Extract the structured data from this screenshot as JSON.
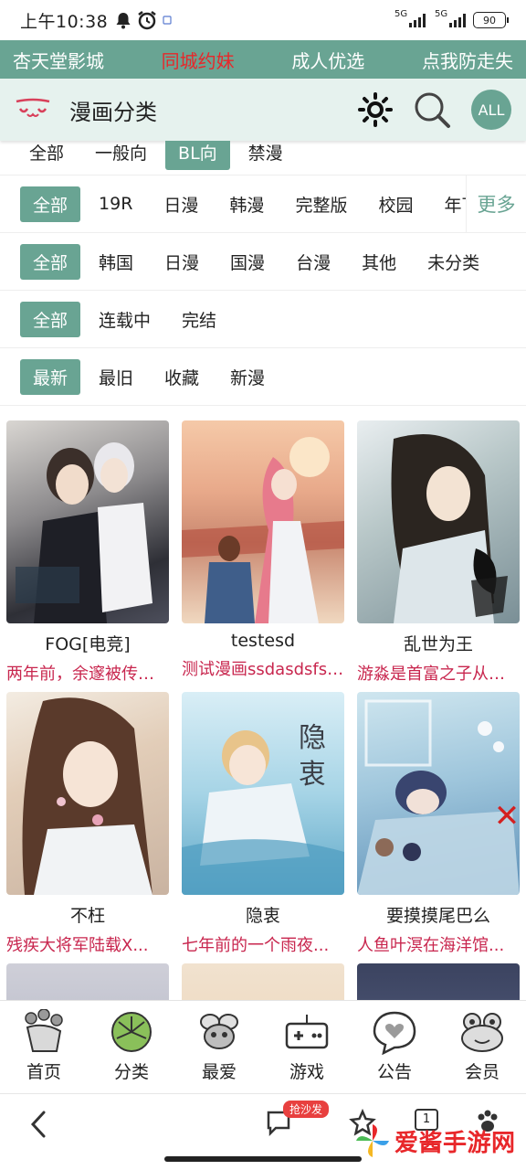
{
  "status": {
    "time": "上午10:38",
    "network1": "5G",
    "network2": "5G",
    "battery": "90"
  },
  "topnav": {
    "links": [
      "杏天堂影城",
      "同城约妹",
      "成人优选",
      "点我防走失"
    ]
  },
  "header": {
    "title": "漫画分类",
    "all_label": "ALL"
  },
  "filters": {
    "row0": [
      "全部",
      "一般向",
      "BL向",
      "禁漫"
    ],
    "row1": [
      "全部",
      "19R",
      "日漫",
      "韩漫",
      "完整版",
      "校园",
      "年下"
    ],
    "more_label": "更多",
    "row2": [
      "全部",
      "韩国",
      "日漫",
      "国漫",
      "台漫",
      "其他",
      "未分类"
    ],
    "row3": [
      "全部",
      "连载中",
      "完结"
    ],
    "row4": [
      "最新",
      "最旧",
      "收藏",
      "新漫"
    ]
  },
  "comics": [
    {
      "title": "FOG[电竞]",
      "desc": "两年前，余邃被传出..."
    },
    {
      "title": "testesd",
      "desc": "测试漫画ssdasdsfsdfsd"
    },
    {
      "title": "乱世为王",
      "desc": "游淼是首富之子从小..."
    },
    {
      "title": "不枉",
      "desc": "残疾大将军陆载X..."
    },
    {
      "title": "隐衷",
      "desc": "七年前的一个雨夜..."
    },
    {
      "title": "要摸摸尾巴么",
      "desc": "人鱼叶溟在海洋馆..."
    }
  ],
  "tabs": [
    "首页",
    "分类",
    "最爱",
    "游戏",
    "公告",
    "会员"
  ],
  "browser": {
    "badge": "抢沙发",
    "tab_count": "1"
  },
  "watermark": "爱酱手游网",
  "colors": {
    "accent": "#69a493",
    "hot": "#e8272a",
    "desc": "#c8264e"
  }
}
